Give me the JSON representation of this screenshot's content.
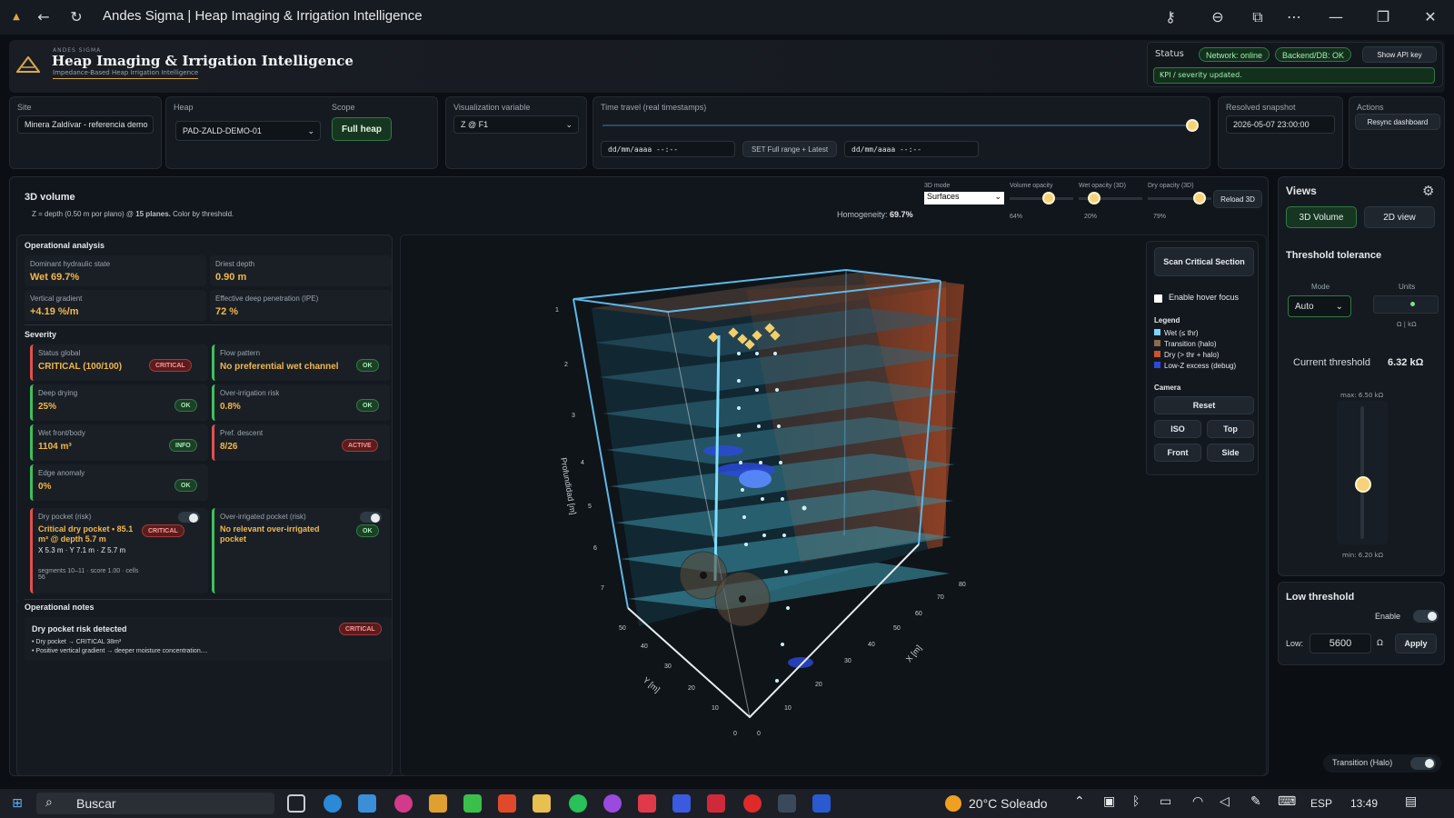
{
  "window": {
    "title": "Andes Sigma | Heap Imaging & Irrigation Intelligence"
  },
  "header": {
    "brand_small": "ANDES SIGMA",
    "title": "Heap Imaging & Irrigation Intelligence",
    "subtitle": "Impedance-Based Heap Irrigation Intelligence",
    "status_label": "Status",
    "network": "Network: online",
    "backend": "Backend/DB: OK",
    "api_btn": "Show API key",
    "kpi_msg": "KPI / severity updated."
  },
  "controls": {
    "site_label": "Site",
    "site_value": "Minera Zaldívar - referencia demo",
    "heap_label": "Heap",
    "heap_value": "PAD-ZALD-DEMO-01",
    "scope_label": "Scope",
    "scope_btn": "Full heap",
    "viz_label": "Visualization variable",
    "viz_value": "Z @ F1",
    "time_label": "Time travel (real timestamps)",
    "date_from_placeholder": "dd/mm/aaaa --:--",
    "date_to_placeholder": "dd/mm/aaaa --:--",
    "set_range_btn": "SET Full range + Latest",
    "snapshot_label": "Resolved snapshot",
    "snapshot_value": "2026-05-07 23:00:00",
    "actions_label": "Actions",
    "resync_btn": "Resync dashboard"
  },
  "volume": {
    "title": "3D volume",
    "desc_pre": "Z = depth (0.50 m por plano) @ ",
    "desc_bold": "15 planes.",
    "desc_post": " Color by threshold.",
    "homogeneity_label": "Homogeneity:",
    "homogeneity_value": "69.7%",
    "mode_label": "3D mode",
    "mode_value": "Surfaces",
    "vol_op_label": "Volume opacity",
    "vol_op_value": "64%",
    "wet_op_label": "Wet opacity (3D)",
    "wet_op_value": "20%",
    "dry_op_label": "Dry opacity (3D)",
    "dry_op_value": "79%",
    "reload_btn": "Reload 3D",
    "axis_depth": "Profundidad [m]",
    "axis_x": "X [m]",
    "axis_y": "Y [m]",
    "depth_ticks": [
      "1",
      "2",
      "3",
      "4",
      "5",
      "6",
      "7"
    ],
    "x_ticks": [
      "0",
      "10",
      "20",
      "30",
      "40",
      "50",
      "60",
      "70",
      "80"
    ],
    "y_ticks": [
      "0",
      "10",
      "20",
      "30",
      "40",
      "50"
    ]
  },
  "analysis": {
    "title": "Operational analysis",
    "metrics": [
      {
        "label": "Dominant hydraulic state",
        "value": "Wet 69.7%"
      },
      {
        "label": "Driest depth",
        "value": "0.90 m"
      },
      {
        "label": "Vertical gradient",
        "value": "+4.19 %/m"
      },
      {
        "label": "Effective deep penetration (IPE)",
        "value": "72 %"
      }
    ],
    "severity_title": "Severity",
    "severity": [
      {
        "label": "Status global",
        "value": "CRITICAL (100/100)",
        "badge": "CRITICAL"
      },
      {
        "label": "Flow pattern",
        "value": "No preferential wet channel",
        "badge": "OK"
      },
      {
        "label": "Deep drying",
        "value": "25%",
        "badge": "OK"
      },
      {
        "label": "Over-irrigation risk",
        "value": "0.8%",
        "badge": "OK"
      },
      {
        "label": "Wet front/body",
        "value": "1104 m³",
        "badge": "INFO"
      },
      {
        "label": "Pref. descent",
        "value": "8/26",
        "badge": "ACTIVE"
      },
      {
        "label": "Edge anomaly",
        "value": "0%",
        "badge": "OK"
      }
    ],
    "dry_pocket": {
      "label": "Dry pocket (risk)",
      "value": "Critical dry pocket • 85.1 m³ @ depth 5.7 m",
      "coords": "X 5.3 m · Y 7.1 m · Z 5.7 m",
      "meta": "segments 10–11 · score 1.00 · cells 56",
      "badge": "CRITICAL"
    },
    "over_pocket": {
      "label": "Over-irrigated pocket (risk)",
      "value": "No relevant over-irrigated pocket",
      "badge": "OK"
    },
    "notes_title": "Operational notes",
    "note_title": "Dry pocket risk detected",
    "note_badge": "CRITICAL",
    "note_line1": "• Dry pocket → CRITICAL 38m³",
    "note_line2": "• Positive vertical gradient → deeper moisture concentration...."
  },
  "overlay": {
    "scan_btn": "Scan Critical Section",
    "hover_label": "Enable hover focus",
    "legend_title": "Legend",
    "legend": [
      {
        "label": "Wet (≤ thr)",
        "color": "#7fd3ff"
      },
      {
        "label": "Transition (halo)",
        "color": "#8a6a4a"
      },
      {
        "label": "Dry (> thr + halo)",
        "color": "#c8552a"
      },
      {
        "label": "Low-Z excess (debug)",
        "color": "#2a4adf"
      }
    ],
    "camera_title": "Camera",
    "reset": "Reset",
    "iso": "ISO",
    "top": "Top",
    "front": "Front",
    "side": "Side"
  },
  "views": {
    "title": "Views",
    "tab_3d": "3D Volume",
    "tab_2d": "2D view",
    "threshold_title": "Threshold tolerance",
    "mode_label": "Mode",
    "mode_value": "Auto",
    "units_label": "Units",
    "units_value": "Ω | kΩ",
    "current_label": "Current threshold",
    "current_value": "6.32  kΩ",
    "max_label": "max: 6.50 kΩ",
    "min_label": "min: 6.20 kΩ",
    "threshold_fraction": 0.4,
    "low_title": "Low threshold",
    "enable_label": "Enable",
    "low_label": "Low:",
    "low_value": "5600",
    "low_unit": "Ω",
    "apply_btn": "Apply",
    "transition_label": "Transition (Halo)"
  },
  "taskbar": {
    "search": "Buscar",
    "weather": "20°C  Soleado",
    "lang": "ESP",
    "time": "13:49"
  }
}
